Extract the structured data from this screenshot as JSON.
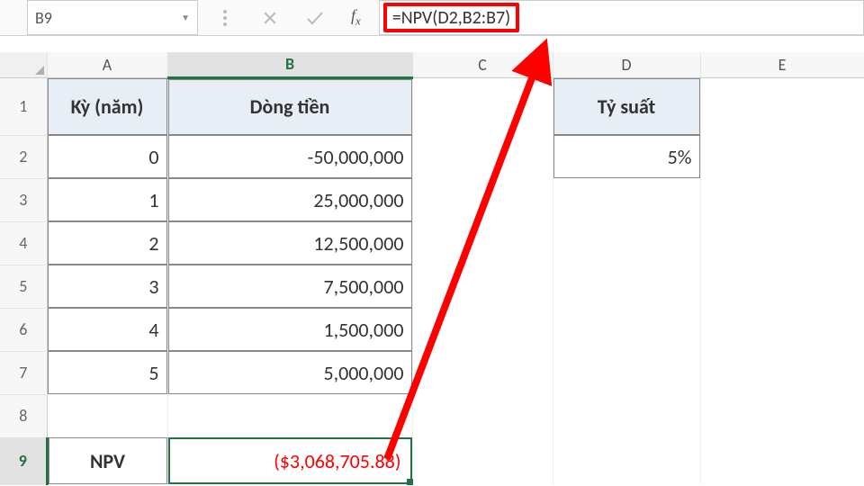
{
  "name_box": "B9",
  "formula": "=NPV(D2,B2:B7)",
  "columns": [
    "A",
    "B",
    "C",
    "D",
    "E"
  ],
  "rows": [
    "1",
    "2",
    "3",
    "4",
    "5",
    "6",
    "7",
    "8",
    "9"
  ],
  "active_col": "B",
  "active_row": "9",
  "headers": {
    "A1": "Kỳ (năm)",
    "B1": "Dòng tiền",
    "D1": "Tỷ suất"
  },
  "cells": {
    "A2": "0",
    "B2": "-50,000,000",
    "A3": "1",
    "B3": "25,000,000",
    "A4": "2",
    "B4": "12,500,000",
    "A5": "3",
    "B5": "7,500,000",
    "A6": "4",
    "B6": "1,500,000",
    "A7": "5",
    "B7": "5,000,000",
    "D2": "5%",
    "A9": "NPV",
    "B9": "($3,068,705.88)"
  },
  "chart_data": {
    "type": "table",
    "title": "NPV calculation",
    "columns": [
      "Kỳ (năm)",
      "Dòng tiền"
    ],
    "rows": [
      [
        0,
        -50000000
      ],
      [
        1,
        25000000
      ],
      [
        2,
        12500000
      ],
      [
        3,
        7500000
      ],
      [
        4,
        1500000
      ],
      [
        5,
        5000000
      ]
    ],
    "parameters": {
      "Tỷ suất": 0.05
    },
    "result": {
      "NPV": -3068705.88,
      "formula": "=NPV(D2,B2:B7)"
    }
  }
}
